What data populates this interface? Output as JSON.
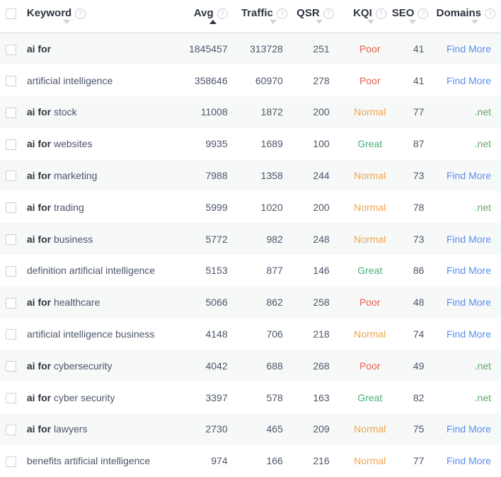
{
  "table": {
    "select_all_checkbox": "",
    "columns": [
      {
        "key": "checkbox",
        "label": "",
        "help": "?",
        "sort": "none",
        "align": "center"
      },
      {
        "key": "keyword",
        "label": "Keyword",
        "help": "?",
        "sort": "desc",
        "align": "left"
      },
      {
        "key": "avg",
        "label": "Avg",
        "help": "?",
        "sort": "asc-active",
        "align": "right"
      },
      {
        "key": "traffic",
        "label": "Traffic",
        "help": "?",
        "sort": "desc",
        "align": "right"
      },
      {
        "key": "qsr",
        "label": "QSR",
        "help": "?",
        "sort": "desc",
        "align": "right"
      },
      {
        "key": "kqi",
        "label": "KQI",
        "help": "?",
        "sort": "desc",
        "align": "center"
      },
      {
        "key": "seo",
        "label": "SEO",
        "help": "?",
        "sort": "desc",
        "align": "right"
      },
      {
        "key": "domains",
        "label": "Domains",
        "help": "?",
        "sort": "desc",
        "align": "right"
      }
    ],
    "colors": {
      "poor": "#e8604c",
      "normal": "#f0a64a",
      "great": "#4caf7d",
      "find_more_link": "#5b8ef5",
      "domain_net": "#5fae5f",
      "row_stripe": "#f7f8f8",
      "row_base": "#ffffff",
      "header_border": "#d4d7dc"
    },
    "rows": [
      {
        "keyword_bold": "ai for",
        "keyword_rest": "",
        "avg": "1845457",
        "traffic": "313728",
        "qsr": "251",
        "kqi": "Poor",
        "kqi_class": "poor",
        "seo": "41",
        "domains": "Find More",
        "domains_class": "link"
      },
      {
        "keyword_bold": "",
        "keyword_rest": "artificial intelligence",
        "avg": "358646",
        "traffic": "60970",
        "qsr": "278",
        "kqi": "Poor",
        "kqi_class": "poor",
        "seo": "41",
        "domains": "Find More",
        "domains_class": "link"
      },
      {
        "keyword_bold": "ai for",
        "keyword_rest": " stock",
        "avg": "11008",
        "traffic": "1872",
        "qsr": "200",
        "kqi": "Normal",
        "kqi_class": "normal",
        "seo": "77",
        "domains": ".net",
        "domains_class": "net"
      },
      {
        "keyword_bold": "ai for",
        "keyword_rest": " websites",
        "avg": "9935",
        "traffic": "1689",
        "qsr": "100",
        "kqi": "Great",
        "kqi_class": "great",
        "seo": "87",
        "domains": ".net",
        "domains_class": "net"
      },
      {
        "keyword_bold": "ai for",
        "keyword_rest": " marketing",
        "avg": "7988",
        "traffic": "1358",
        "qsr": "244",
        "kqi": "Normal",
        "kqi_class": "normal",
        "seo": "73",
        "domains": "Find More",
        "domains_class": "link"
      },
      {
        "keyword_bold": "ai for",
        "keyword_rest": " trading",
        "avg": "5999",
        "traffic": "1020",
        "qsr": "200",
        "kqi": "Normal",
        "kqi_class": "normal",
        "seo": "78",
        "domains": ".net",
        "domains_class": "net"
      },
      {
        "keyword_bold": "ai for",
        "keyword_rest": " business",
        "avg": "5772",
        "traffic": "982",
        "qsr": "248",
        "kqi": "Normal",
        "kqi_class": "normal",
        "seo": "73",
        "domains": "Find More",
        "domains_class": "link"
      },
      {
        "keyword_bold": "",
        "keyword_rest": "definition artificial intelligence",
        "avg": "5153",
        "traffic": "877",
        "qsr": "146",
        "kqi": "Great",
        "kqi_class": "great",
        "seo": "86",
        "domains": "Find More",
        "domains_class": "link"
      },
      {
        "keyword_bold": "ai for",
        "keyword_rest": " healthcare",
        "avg": "5066",
        "traffic": "862",
        "qsr": "258",
        "kqi": "Poor",
        "kqi_class": "poor",
        "seo": "48",
        "domains": "Find More",
        "domains_class": "link"
      },
      {
        "keyword_bold": "",
        "keyword_rest": "artificial intelligence business",
        "avg": "4148",
        "traffic": "706",
        "qsr": "218",
        "kqi": "Normal",
        "kqi_class": "normal",
        "seo": "74",
        "domains": "Find More",
        "domains_class": "link"
      },
      {
        "keyword_bold": "ai for",
        "keyword_rest": " cybersecurity",
        "avg": "4042",
        "traffic": "688",
        "qsr": "268",
        "kqi": "Poor",
        "kqi_class": "poor",
        "seo": "49",
        "domains": ".net",
        "domains_class": "net"
      },
      {
        "keyword_bold": "ai for",
        "keyword_rest": " cyber security",
        "avg": "3397",
        "traffic": "578",
        "qsr": "163",
        "kqi": "Great",
        "kqi_class": "great",
        "seo": "82",
        "domains": ".net",
        "domains_class": "net"
      },
      {
        "keyword_bold": "ai for",
        "keyword_rest": " lawyers",
        "avg": "2730",
        "traffic": "465",
        "qsr": "209",
        "kqi": "Normal",
        "kqi_class": "normal",
        "seo": "75",
        "domains": "Find More",
        "domains_class": "link"
      },
      {
        "keyword_bold": "",
        "keyword_rest": "benefits artificial intelligence",
        "avg": "974",
        "traffic": "166",
        "qsr": "216",
        "kqi": "Normal",
        "kqi_class": "normal",
        "seo": "77",
        "domains": "Find More",
        "domains_class": "link"
      }
    ]
  }
}
